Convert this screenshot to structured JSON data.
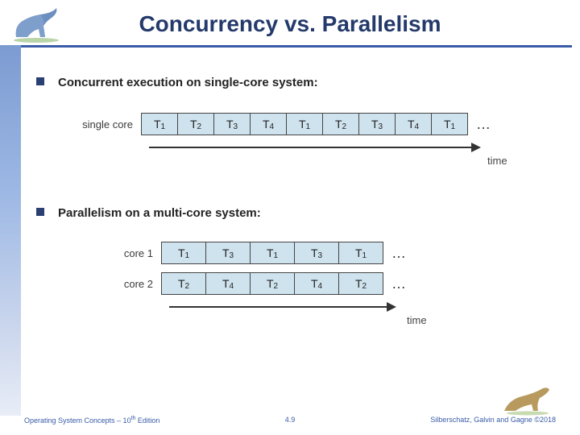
{
  "title": "Concurrency vs. Parallelism",
  "bullets": {
    "b1": "Concurrent execution on single-core system:",
    "b2": "Parallelism on a multi-core system:"
  },
  "diagram1": {
    "rowlabel": "single core",
    "cells": [
      "T1",
      "T2",
      "T3",
      "T4",
      "T1",
      "T2",
      "T3",
      "T4",
      "T1"
    ],
    "dots": "…",
    "timelabel": "time"
  },
  "diagram2": {
    "row1label": "core 1",
    "row1cells": [
      "T1",
      "T3",
      "T1",
      "T3",
      "T1"
    ],
    "row2label": "core 2",
    "row2cells": [
      "T2",
      "T4",
      "T2",
      "T4",
      "T2"
    ],
    "dots": "…",
    "timelabel": "time"
  },
  "footer": {
    "left_a": "Operating System Concepts – 10",
    "left_sup": "th",
    "left_b": " Edition",
    "center": "4.9",
    "right": "Silberschatz, Galvin and Gagne ©2018"
  },
  "colors": {
    "heading": "#243a6b",
    "rule": "#3a5ca8",
    "cellbg": "#cfe3ee"
  }
}
